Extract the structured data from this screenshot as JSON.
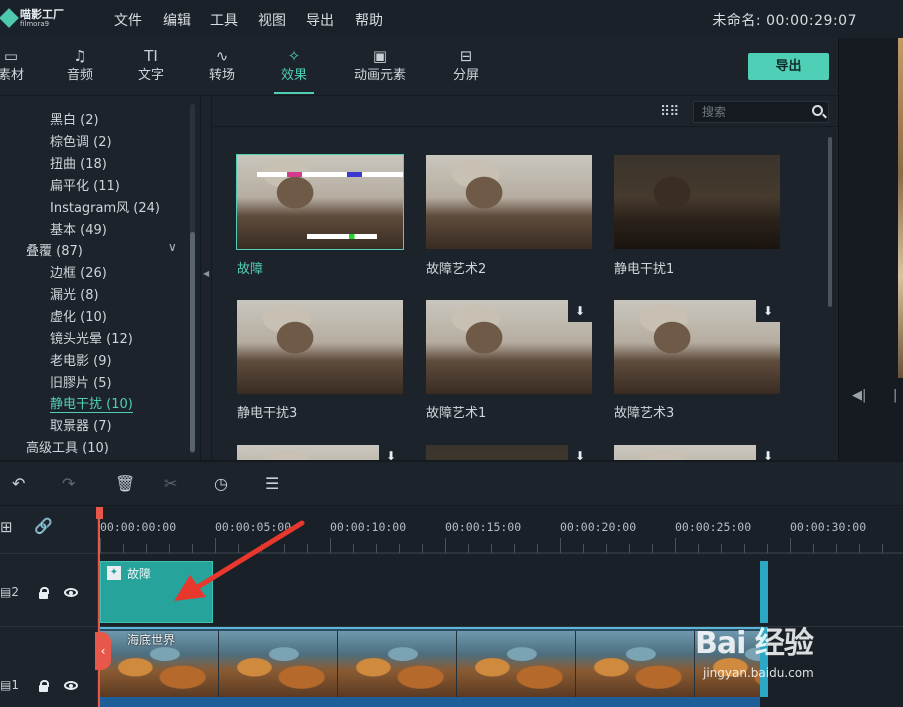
{
  "app": {
    "logo_name": "喵影工厂",
    "logo_sub": "filmora9",
    "menu": [
      "文件",
      "编辑",
      "工具",
      "视图",
      "导出",
      "帮助"
    ],
    "project_title": "未命名: 00:00:29:07"
  },
  "tabs": [
    {
      "label": "素材",
      "icon": "folder-icon"
    },
    {
      "label": "音频",
      "icon": "music-note-icon"
    },
    {
      "label": "文字",
      "icon": "text-icon"
    },
    {
      "label": "转场",
      "icon": "transition-icon"
    },
    {
      "label": "效果",
      "icon": "effects-icon",
      "active": true
    },
    {
      "label": "动画元素",
      "icon": "image-icon"
    },
    {
      "label": "分屏",
      "icon": "split-screen-icon"
    }
  ],
  "export_label": "导出",
  "categories": [
    {
      "label": "黑白 (2)"
    },
    {
      "label": "棕色调 (2)"
    },
    {
      "label": "扭曲 (18)"
    },
    {
      "label": "扁平化 (11)"
    },
    {
      "label": "Instagram风 (24)"
    },
    {
      "label": "基本 (49)"
    },
    {
      "label": "叠覆 (87)",
      "parent": true,
      "expanded": true
    },
    {
      "label": "边框 (26)"
    },
    {
      "label": "漏光 (8)"
    },
    {
      "label": "虚化 (10)"
    },
    {
      "label": "镜头光晕 (12)"
    },
    {
      "label": "老电影 (9)"
    },
    {
      "label": "旧膠片 (5)"
    },
    {
      "label": "静电干扰 (10)",
      "active": true
    },
    {
      "label": "取景器 (7)"
    },
    {
      "label": "高级工具 (10)",
      "parent": true
    }
  ],
  "search": {
    "placeholder": "搜索",
    "value": ""
  },
  "effects": [
    {
      "label": "故障",
      "selected": true,
      "download": false
    },
    {
      "label": "故障艺术2",
      "download": false
    },
    {
      "label": "静电干扰1",
      "download": false
    },
    {
      "label": "静电干扰3",
      "download": false
    },
    {
      "label": "故障艺术1",
      "download": true
    },
    {
      "label": "故障艺术3",
      "download": true
    },
    {
      "label": "",
      "download": true
    },
    {
      "label": "",
      "download": true
    },
    {
      "label": "",
      "download": true
    }
  ],
  "timeline": {
    "ticks": [
      "00:00:00:00",
      "00:00:05:00",
      "00:00:10:00",
      "00:00:15:00",
      "00:00:20:00",
      "00:00:25:00",
      "00:00:30:00"
    ],
    "tracks": [
      {
        "number": "2",
        "clip_label": "故障"
      },
      {
        "number": "1",
        "clip_label": "海底世界"
      }
    ]
  },
  "watermark": {
    "text": "Bai 经验",
    "url": "jingyan.baidu.com"
  },
  "colors": {
    "accent": "#4fd0b6",
    "playhead": "#e8584a",
    "effect_clip": "#26a39a"
  }
}
